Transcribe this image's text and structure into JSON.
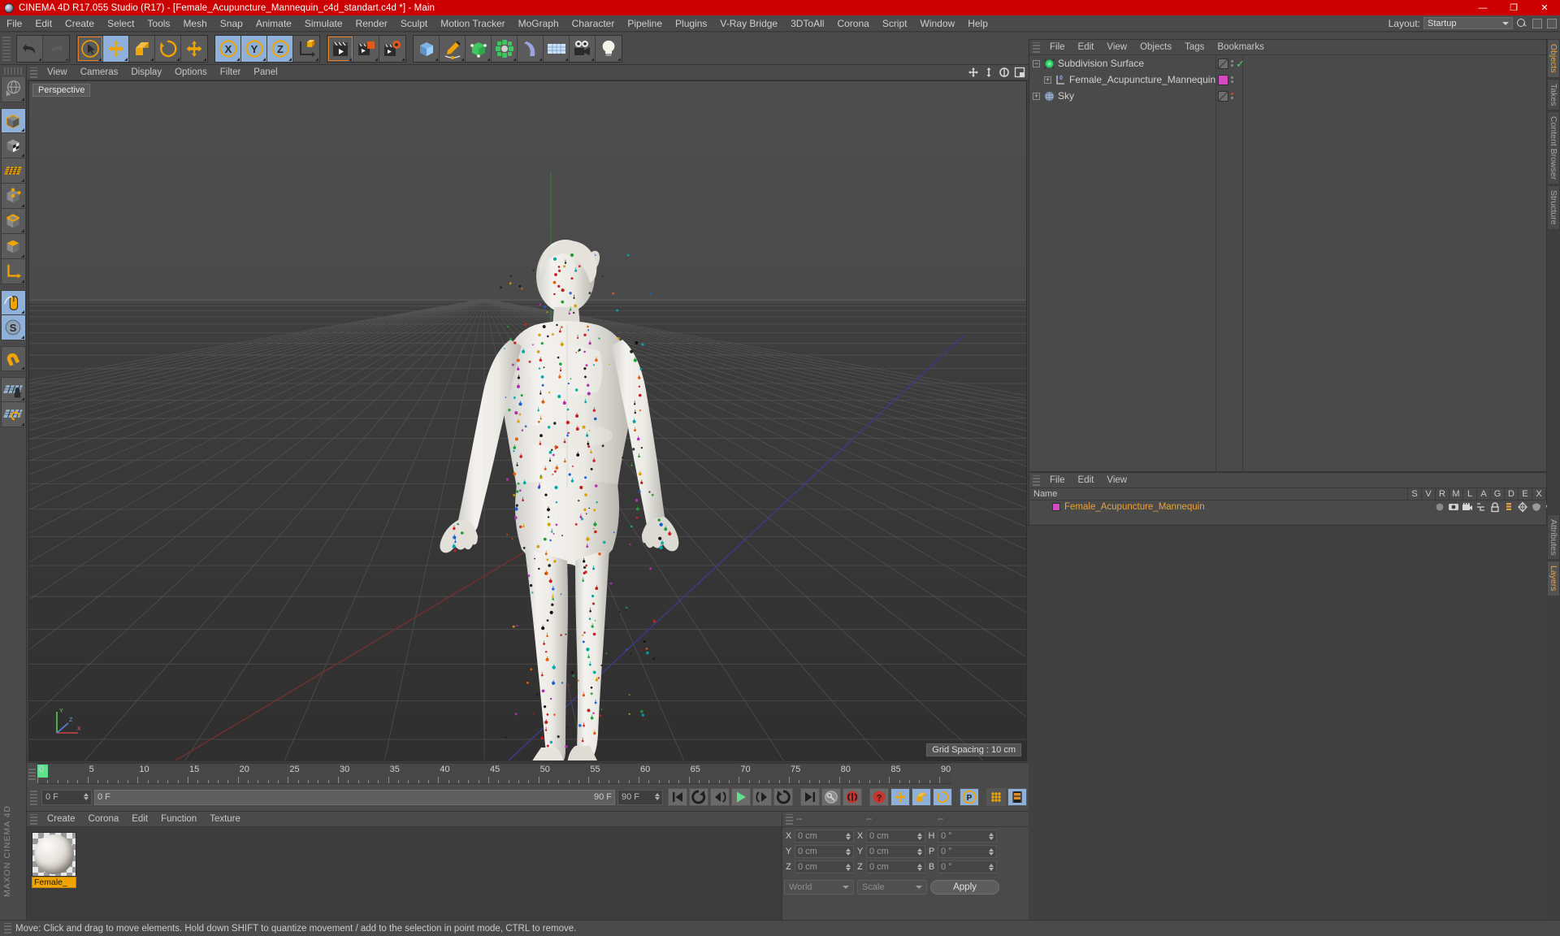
{
  "window": {
    "title": "CINEMA 4D R17.055 Studio (R17) - [Female_Acupuncture_Mannequin_c4d_standart.c4d *] - Main",
    "minimize": "—",
    "maximize": "❐",
    "close": "✕"
  },
  "menubar": {
    "items": [
      "File",
      "Edit",
      "Create",
      "Select",
      "Tools",
      "Mesh",
      "Snap",
      "Animate",
      "Simulate",
      "Render",
      "Sculpt",
      "Motion Tracker",
      "MoGraph",
      "Character",
      "Pipeline",
      "Plugins",
      "V-Ray Bridge",
      "3DToAll",
      "Corona",
      "Script",
      "Window",
      "Help"
    ],
    "layout_label": "Layout:",
    "layout_value": "Startup"
  },
  "toolbar": {
    "buttons": [
      {
        "name": "undo-button",
        "icon": "undo-icon",
        "state": "normal"
      },
      {
        "name": "redo-button",
        "icon": "redo-icon",
        "state": "disabled"
      },
      {
        "name": "live-selection-button",
        "icon": "cursor-circle-icon",
        "state": "selected"
      },
      {
        "name": "move-button",
        "icon": "move-icon",
        "state": "active"
      },
      {
        "name": "scale-button",
        "icon": "scale-icon",
        "state": "normal"
      },
      {
        "name": "rotate-button",
        "icon": "rotate-icon",
        "state": "normal"
      },
      {
        "name": "move-axis-button",
        "icon": "move-icon",
        "state": "normal"
      },
      {
        "name": "x-axis-lock-button",
        "icon": "x-axis-icon",
        "state": "active"
      },
      {
        "name": "y-axis-lock-button",
        "icon": "y-axis-icon",
        "state": "active"
      },
      {
        "name": "z-axis-lock-button",
        "icon": "z-axis-icon",
        "state": "active"
      },
      {
        "name": "world-coordinate-button",
        "icon": "world-axis-icon",
        "state": "normal"
      },
      {
        "name": "render-view-button",
        "icon": "render-clapper-icon",
        "state": "selected"
      },
      {
        "name": "render-region-button",
        "icon": "render-region-icon",
        "state": "normal"
      },
      {
        "name": "render-settings-button",
        "icon": "render-settings-icon",
        "state": "normal"
      },
      {
        "name": "cube-primitive-button",
        "icon": "cube-icon",
        "state": "normal"
      },
      {
        "name": "spline-pen-button",
        "icon": "pen-icon",
        "state": "normal"
      },
      {
        "name": "generator-button",
        "icon": "green-cube-icon",
        "state": "normal"
      },
      {
        "name": "mograph-cloner-button",
        "icon": "cloner-icon",
        "state": "normal"
      },
      {
        "name": "deformer-button",
        "icon": "bend-icon",
        "state": "normal"
      },
      {
        "name": "environment-button",
        "icon": "floor-grid-icon",
        "state": "normal"
      },
      {
        "name": "camera-button",
        "icon": "camera-icon",
        "state": "normal"
      },
      {
        "name": "light-button",
        "icon": "light-bulb-icon",
        "state": "normal"
      }
    ]
  },
  "left_toolbar": {
    "buttons": [
      {
        "name": "make-editable-button",
        "icon": "globe-editable-icon",
        "state": "normal"
      },
      {
        "name": "model-mode-button",
        "icon": "model-cube-icon",
        "state": "active"
      },
      {
        "name": "texture-mode-button",
        "icon": "texture-cube-icon",
        "state": "normal"
      },
      {
        "name": "uv-mesh-button",
        "icon": "uv-grid-icon",
        "state": "normal"
      },
      {
        "name": "point-mode-button",
        "icon": "points-cube-icon",
        "state": "normal"
      },
      {
        "name": "edge-mode-button",
        "icon": "edge-cube-icon",
        "state": "normal"
      },
      {
        "name": "polygon-mode-button",
        "icon": "polygon-cube-icon",
        "state": "normal"
      },
      {
        "name": "axis-mode-button",
        "icon": "axis-icon",
        "state": "normal"
      },
      {
        "name": "viewport-solo-button",
        "icon": "mouse-icon",
        "state": "active"
      },
      {
        "name": "tweak-mode-button",
        "icon": "s-compass-icon",
        "state": "active"
      },
      {
        "name": "magnet-button",
        "icon": "magnet-icon",
        "state": "normal"
      },
      {
        "name": "workplane-lock-button",
        "icon": "grid-lock-icon",
        "state": "normal"
      },
      {
        "name": "workplane-button",
        "icon": "grid-icon",
        "state": "normal"
      }
    ],
    "brand": "MAXON CINEMA 4D"
  },
  "viewport": {
    "menu": [
      "View",
      "Cameras",
      "Display",
      "Options",
      "Filter",
      "Panel"
    ],
    "label": "Perspective",
    "grid_spacing": "Grid Spacing : 10 cm",
    "axis_labels": {
      "x": "X",
      "y": "Y",
      "z": "Z"
    },
    "icons": [
      "pan-icon",
      "zoom-icon",
      "rotate-icon",
      "layout-icon"
    ]
  },
  "timeline": {
    "ticks": [
      "0",
      "5",
      "10",
      "15",
      "20",
      "25",
      "30",
      "35",
      "40",
      "45",
      "50",
      "55",
      "60",
      "65",
      "70",
      "75",
      "80",
      "85",
      "90"
    ],
    "current_frame": "0 F",
    "start_frame": "0 F",
    "end_frame": "90 F",
    "preview_end": "90 F",
    "field_end": "0 F",
    "controls": [
      {
        "name": "go-to-start-button",
        "icon": "skip-start-icon"
      },
      {
        "name": "play-backward-button",
        "icon": "rewind-loop-icon"
      },
      {
        "name": "previous-frame-button",
        "icon": "step-back-icon"
      },
      {
        "name": "play-button",
        "icon": "play-icon"
      },
      {
        "name": "next-frame-button",
        "icon": "step-forward-icon"
      },
      {
        "name": "play-forward-loop-button",
        "icon": "forward-loop-icon"
      },
      {
        "name": "go-to-end-button",
        "icon": "skip-end-icon"
      },
      {
        "name": "record-key-button",
        "icon": "key-icon"
      },
      {
        "name": "autokey-button",
        "icon": "autokey-icon"
      },
      {
        "name": "keyframe-selection-button",
        "icon": "question-icon"
      },
      {
        "name": "position-key-button",
        "icon": "move-icon"
      },
      {
        "name": "scale-key-button",
        "icon": "scale-icon"
      },
      {
        "name": "rotation-key-button",
        "icon": "rotate-icon"
      },
      {
        "name": "param-key-button",
        "icon": "p-circle-icon"
      },
      {
        "name": "point-level-anim-button",
        "icon": "dots-grid-icon"
      },
      {
        "name": "timeline-button",
        "icon": "filmstrip-icon"
      }
    ]
  },
  "material_manager": {
    "menu": [
      "Create",
      "Corona",
      "Edit",
      "Function",
      "Texture"
    ],
    "materials": [
      {
        "name": "Female_",
        "icon": "material-sphere-icon"
      }
    ]
  },
  "coordinates": {
    "head_left": "--",
    "head_mid": "--",
    "head_right": "--",
    "position": [
      {
        "label": "X",
        "value": "0 cm"
      },
      {
        "label": "Y",
        "value": "0 cm"
      },
      {
        "label": "Z",
        "value": "0 cm"
      }
    ],
    "size": [
      {
        "label": "X",
        "value": "0 cm"
      },
      {
        "label": "Y",
        "value": "0 cm"
      },
      {
        "label": "Z",
        "value": "0 cm"
      }
    ],
    "rotation": [
      {
        "label": "H",
        "value": "0 °"
      },
      {
        "label": "P",
        "value": "0 °"
      },
      {
        "label": "B",
        "value": "0 °"
      }
    ],
    "system": "World",
    "mode": "Scale",
    "apply": "Apply"
  },
  "object_manager": {
    "menu": [
      "File",
      "Edit",
      "View",
      "Objects",
      "Tags",
      "Bookmarks"
    ],
    "rows": [
      {
        "name": "Subdivision Surface",
        "indent": 0,
        "icon": "subdivision-surface-icon",
        "expanded": true,
        "tag": "diag",
        "check": true,
        "dot": "gray"
      },
      {
        "name": "Female_Acupuncture_Mannequin",
        "indent": 1,
        "icon": "polygon-object-icon",
        "expanded": false,
        "tag": "magenta",
        "check": false,
        "dot": "gray"
      },
      {
        "name": "Sky",
        "indent": 0,
        "icon": "sky-icon",
        "expanded": false,
        "tag": "diag",
        "check": false,
        "dot": "red"
      }
    ]
  },
  "layer_manager": {
    "menu": [
      "File",
      "Edit",
      "View"
    ],
    "columns": [
      "Name",
      "S",
      "V",
      "R",
      "M",
      "L",
      "A",
      "G",
      "D",
      "E",
      "X"
    ],
    "rows": [
      {
        "name": "Female_Acupuncture_Mannequin",
        "color": "#d24bc0"
      }
    ]
  },
  "right_tabs": [
    {
      "label": "Objects",
      "active": true
    },
    {
      "label": "Takes",
      "active": false
    },
    {
      "label": "Content Browser",
      "active": false
    },
    {
      "label": "Structure",
      "active": false
    },
    {
      "label": "Attributes",
      "active": false
    },
    {
      "label": "Layers",
      "active": true
    }
  ],
  "statusbar": {
    "text": "Move: Click and drag to move elements. Hold down SHIFT to quantize movement / add to the selection in point mode, CTRL to remove."
  },
  "colors": {
    "accent_red": "#cc0000",
    "panel": "#4a4a4a",
    "active_blue": "#8fb0d8",
    "orange": "#e8a33d",
    "magenta": "#d24bc0",
    "green": "#5fe08c"
  }
}
